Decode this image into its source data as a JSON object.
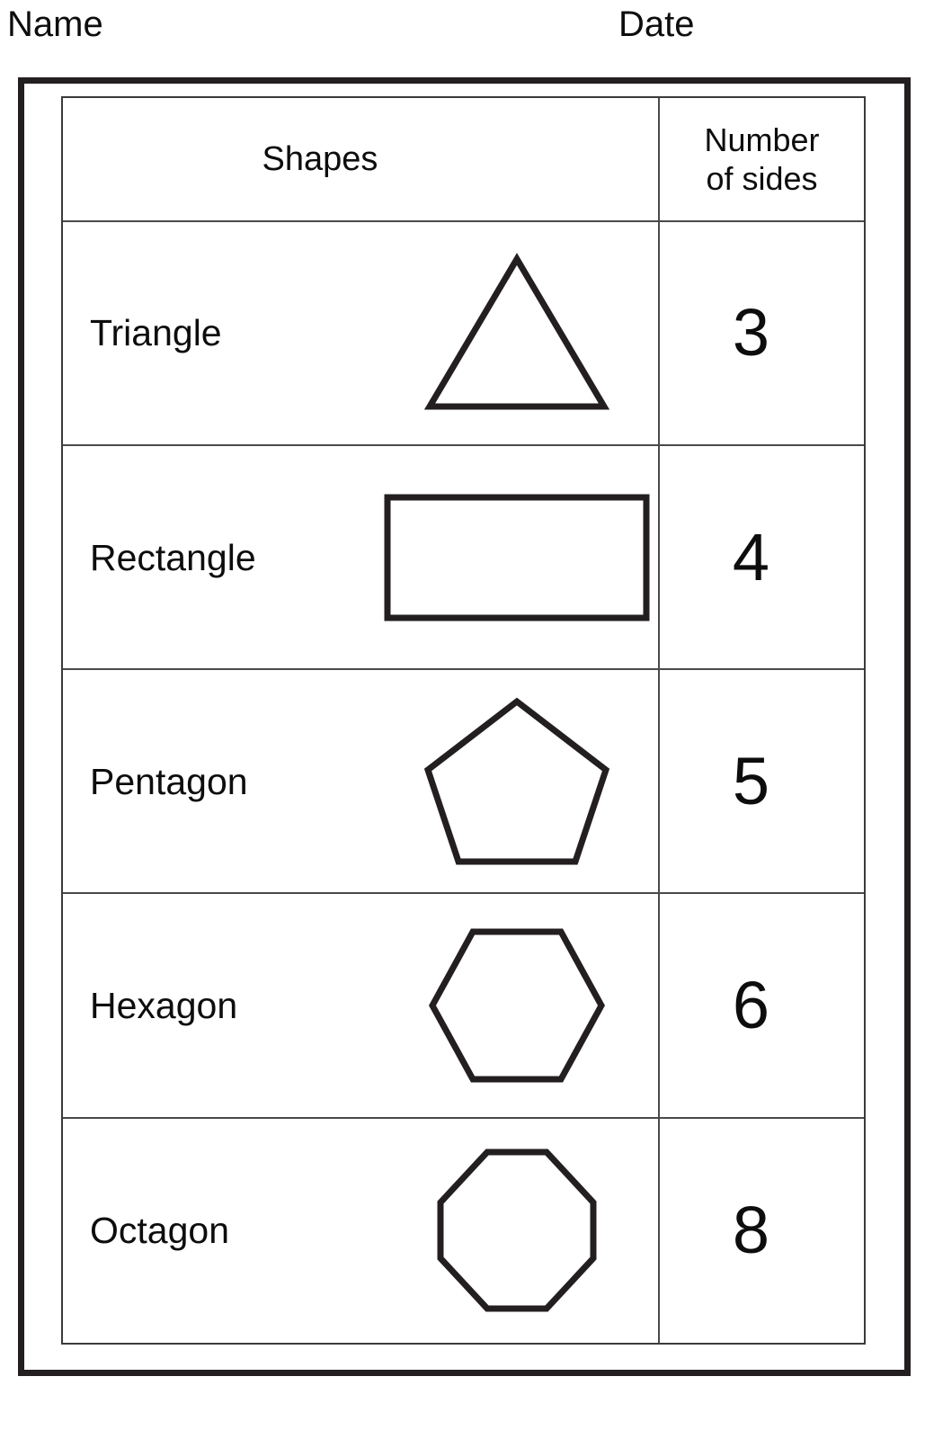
{
  "header": {
    "name_label": "Name",
    "date_label": "Date"
  },
  "table": {
    "columns": [
      {
        "key": "shapes",
        "header": "Shapes"
      },
      {
        "key": "sides",
        "header_line1": "Number",
        "header_line2": "of sides"
      }
    ],
    "rows": [
      {
        "name": "Triangle",
        "shape": "triangle",
        "sides": "3"
      },
      {
        "name": "Rectangle",
        "shape": "rectangle",
        "sides": "4"
      },
      {
        "name": "Pentagon",
        "shape": "pentagon",
        "sides": "5"
      },
      {
        "name": "Hexagon",
        "shape": "hexagon",
        "sides": "6"
      },
      {
        "name": "Octagon",
        "shape": "octagon",
        "sides": "8"
      }
    ]
  },
  "colors": {
    "ink": "#231f20",
    "text": "#0d0d0d",
    "grid": "#4a4a4a",
    "paper": "#ffffff"
  }
}
